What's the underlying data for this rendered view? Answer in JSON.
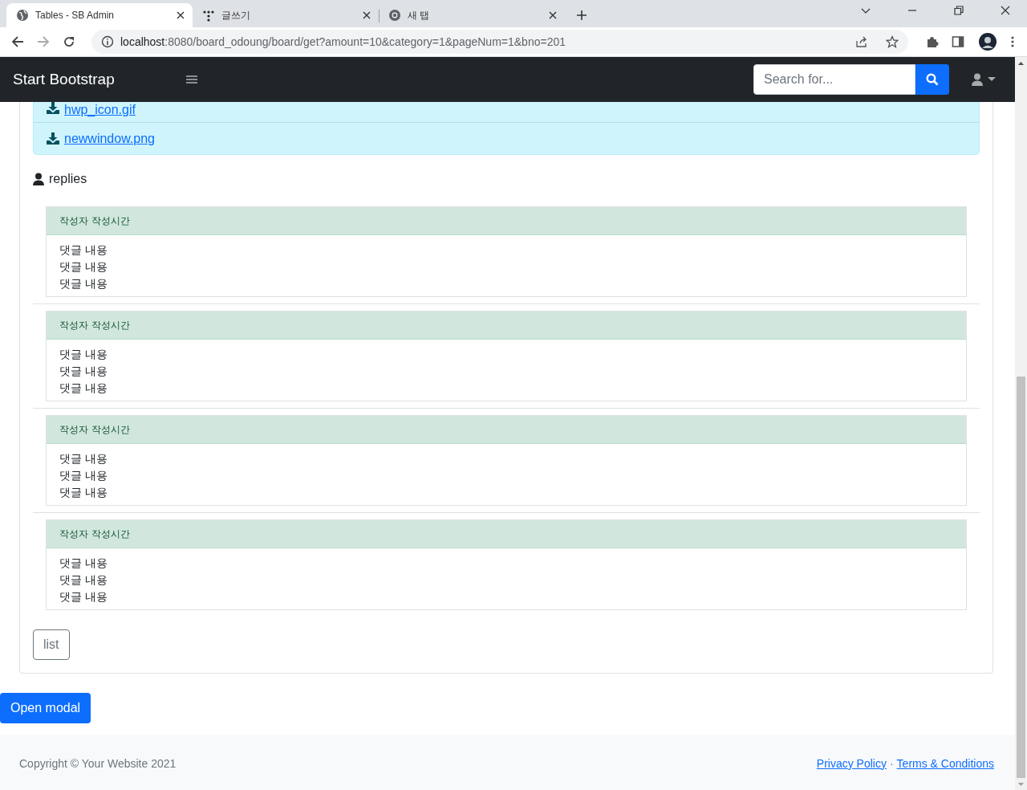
{
  "browser": {
    "tabs": [
      {
        "title": "Tables - SB Admin",
        "selected": true,
        "kind": "globe"
      },
      {
        "title": "글쓰기",
        "selected": false,
        "kind": "dots"
      },
      {
        "title": "새 탭",
        "selected": false,
        "kind": "chrome"
      }
    ],
    "address": {
      "host": "localhost",
      "path": ":8080/board_odoung/board/get?amount=10&category=1&pageNum=1&bno=201"
    }
  },
  "navbar": {
    "brand": "Start Bootstrap",
    "search": {
      "placeholder": "Search for..."
    }
  },
  "attachments": [
    "hwp_icon.gif",
    "newwindow.png"
  ],
  "replies_heading": "replies",
  "replies": [
    {
      "header": "작성자 작성시간",
      "lines": [
        "댓글 내용",
        "댓글 내용",
        "댓글 내용"
      ]
    },
    {
      "header": "작성자 작성시간",
      "lines": [
        "댓글 내용",
        "댓글 내용",
        "댓글 내용"
      ]
    },
    {
      "header": "작성자 작성시간",
      "lines": [
        "댓글 내용",
        "댓글 내용",
        "댓글 내용"
      ]
    },
    {
      "header": "작성자 작성시간",
      "lines": [
        "댓글 내용",
        "댓글 내용",
        "댓글 내용"
      ]
    }
  ],
  "list_button": "list",
  "modal_button": "Open modal",
  "footer": {
    "copyright": "Copyright © Your Website 2021",
    "links": [
      "Privacy Policy",
      "Terms & Conditions"
    ],
    "separator": "·"
  }
}
